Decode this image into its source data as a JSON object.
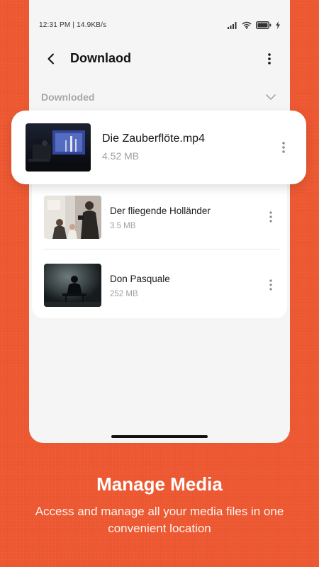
{
  "status_bar": {
    "time_speed": "12:31 PM | 14.9KB/s"
  },
  "header": {
    "title": "Downlaod",
    "back_icon": "back-arrow-icon",
    "menu_icon": "more-vertical-icon"
  },
  "section": {
    "label": "Downloded",
    "collapse_icon": "chevron-down-icon"
  },
  "featured_item": {
    "title": "Die Zauberflöte.mp4",
    "size": "4.52 MB"
  },
  "items": [
    {
      "title": "Der fliegende Holländer",
      "size": "3.5 MB"
    },
    {
      "title": "Don Pasquale",
      "size": "252 MB"
    }
  ],
  "promo": {
    "headline": "Manage Media",
    "description": "Access and manage all your media files in one convenient location"
  },
  "colors": {
    "background": "#F05A33",
    "card": "#FFFFFF",
    "screen": "#F5F5F5",
    "muted_text": "#A0A0A0"
  }
}
